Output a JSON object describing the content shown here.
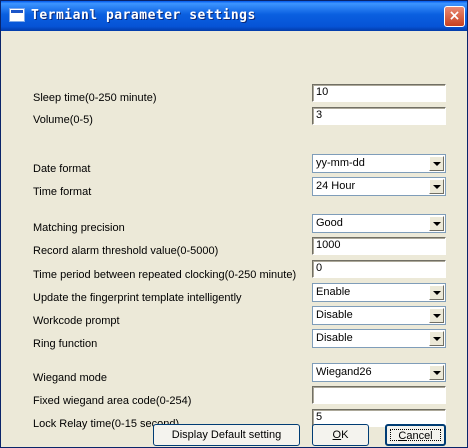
{
  "window": {
    "title": "Termianl parameter settings",
    "close_symbol": "×"
  },
  "fields": {
    "sleep_time": {
      "label": "Sleep time(0-250 minute)",
      "value": "10"
    },
    "volume": {
      "label": "Volume(0-5)",
      "value": "3"
    },
    "date_format": {
      "label": "Date format",
      "value": "yy-mm-dd"
    },
    "time_format": {
      "label": "Time format",
      "value": "24 Hour"
    },
    "matching_precision": {
      "label": "Matching precision",
      "value": "Good"
    },
    "record_alarm": {
      "label": "Record alarm threshold value(0-5000)",
      "value": "1000"
    },
    "repeat_clocking": {
      "label": "Time period between repeated clocking(0-250 minute)",
      "value": "0"
    },
    "update_template": {
      "label": "Update the fingerprint template intelligently",
      "value": "Enable"
    },
    "workcode_prompt": {
      "label": "Workcode prompt",
      "value": "Disable"
    },
    "ring_function": {
      "label": "Ring function",
      "value": "Disable"
    },
    "wiegand_mode": {
      "label": "Wiegand mode",
      "value": "Wiegand26"
    },
    "wiegand_area": {
      "label": "Fixed wiegand area code(0-254)",
      "value": ""
    },
    "lock_relay": {
      "label": "Lock Relay time(0-15 second)",
      "value": "5"
    }
  },
  "buttons": {
    "default_label": "Display Default setting",
    "ok_mnemonic": "O",
    "ok_rest": "K",
    "cancel_mnemonic": "C",
    "cancel_rest": "ancel"
  }
}
